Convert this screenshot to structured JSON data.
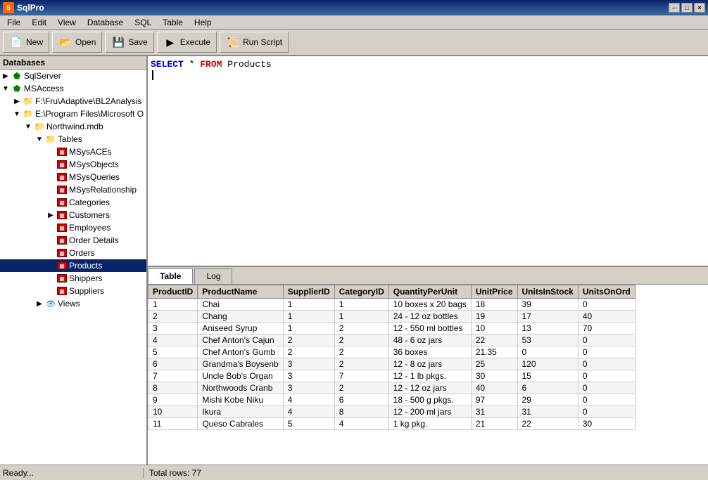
{
  "titleBar": {
    "icon": "S",
    "title": "SqlPro",
    "controls": [
      "─",
      "□",
      "×"
    ]
  },
  "menuBar": {
    "items": [
      "File",
      "Edit",
      "View",
      "Database",
      "SQL",
      "Table",
      "Help"
    ]
  },
  "toolbar": {
    "buttons": [
      {
        "label": "New",
        "icon": "📄"
      },
      {
        "label": "Open",
        "icon": "📂"
      },
      {
        "label": "Save",
        "icon": "💾"
      },
      {
        "label": "Execute",
        "icon": "▶"
      },
      {
        "label": "Run Script",
        "icon": "📜"
      }
    ]
  },
  "sidebar": {
    "header": "Databases",
    "tree": [
      {
        "id": "sqlserver",
        "label": "SqlServer",
        "type": "db",
        "level": 0,
        "expanded": false
      },
      {
        "id": "msaccess",
        "label": "MSAccess",
        "type": "db",
        "level": 0,
        "expanded": true
      },
      {
        "id": "fru",
        "label": "F:\\Fru\\Adaptive\\BL2Analysis",
        "type": "folder",
        "level": 1,
        "expanded": false
      },
      {
        "id": "eprog",
        "label": "E:\\Program Files\\Microsoft O",
        "type": "folder",
        "level": 1,
        "expanded": true
      },
      {
        "id": "northwind",
        "label": "Northwind.mdb",
        "type": "mdb",
        "level": 2,
        "expanded": true
      },
      {
        "id": "tables",
        "label": "Tables",
        "type": "tables-folder",
        "level": 3,
        "expanded": true
      },
      {
        "id": "msysaces",
        "label": "MSysACEs",
        "type": "table",
        "level": 4
      },
      {
        "id": "msysobjects",
        "label": "MSysObjects",
        "type": "table",
        "level": 4
      },
      {
        "id": "msysqueries",
        "label": "MSysQueries",
        "type": "table",
        "level": 4
      },
      {
        "id": "msysrelationship",
        "label": "MSysRelationship",
        "type": "table",
        "level": 4
      },
      {
        "id": "categories",
        "label": "Categories",
        "type": "table",
        "level": 4
      },
      {
        "id": "customers",
        "label": "Customers",
        "type": "table-folder",
        "level": 4,
        "expanded": false
      },
      {
        "id": "employees",
        "label": "Employees",
        "type": "table",
        "level": 4
      },
      {
        "id": "orderdetails",
        "label": "Order Details",
        "type": "table",
        "level": 4
      },
      {
        "id": "orders",
        "label": "Orders",
        "type": "table",
        "level": 4
      },
      {
        "id": "products",
        "label": "Products",
        "type": "table",
        "level": 4,
        "selected": true
      },
      {
        "id": "shippers",
        "label": "Shippers",
        "type": "table",
        "level": 4
      },
      {
        "id": "suppliers",
        "label": "Suppliers",
        "type": "table",
        "level": 4
      },
      {
        "id": "views",
        "label": "Views",
        "type": "views-folder",
        "level": 3
      }
    ]
  },
  "sqlEditor": {
    "content": "SELECT * FROM Products",
    "cursorPos": "line 1"
  },
  "tabs": [
    {
      "label": "Table",
      "active": true
    },
    {
      "label": "Log",
      "active": false
    }
  ],
  "dataTable": {
    "columns": [
      "ProductID",
      "ProductName",
      "SupplierID",
      "CategoryID",
      "QuantityPerUnit",
      "UnitPrice",
      "UnitsInStock",
      "UnitsOnOrd"
    ],
    "rows": [
      [
        1,
        "Chai",
        1,
        1,
        "10 boxes x 20 bags",
        18,
        39,
        0
      ],
      [
        2,
        "Chang",
        1,
        1,
        "24 - 12 oz bottles",
        19,
        17,
        40
      ],
      [
        3,
        "Aniseed Syrup",
        1,
        2,
        "12 - 550 ml bottles",
        10,
        13,
        70
      ],
      [
        4,
        "Chef Anton's Cajun",
        2,
        2,
        "48 - 6 oz jars",
        22,
        53,
        0
      ],
      [
        5,
        "Chef Anton's Gumb",
        2,
        2,
        "36 boxes",
        21.35,
        0,
        0
      ],
      [
        6,
        "Grandma's Boysenb",
        3,
        2,
        "12 - 8 oz jars",
        25,
        120,
        0
      ],
      [
        7,
        "Uncle Bob's Organ",
        3,
        7,
        "12 - 1 lb pkgs.",
        30,
        15,
        0
      ],
      [
        8,
        "Northwoods Cranb",
        3,
        2,
        "12 - 12 oz jars",
        40,
        6,
        0
      ],
      [
        9,
        "Mishi Kobe Niku",
        4,
        6,
        "18 - 500 g pkgs.",
        97,
        29,
        0
      ],
      [
        10,
        "Ikura",
        4,
        8,
        "12 - 200 ml jars",
        31,
        31,
        0
      ],
      [
        11,
        "Queso Cabrales",
        5,
        4,
        "1 kg pkg.",
        21,
        22,
        30
      ]
    ]
  },
  "statusBar": {
    "left": "Ready...",
    "right": "Total rows: 77"
  }
}
